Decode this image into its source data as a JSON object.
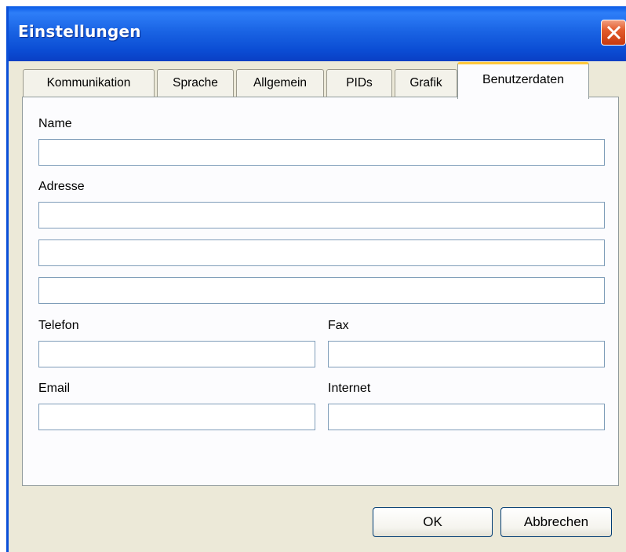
{
  "window": {
    "title": "Einstellungen"
  },
  "tabs": [
    {
      "label": "Kommunikation"
    },
    {
      "label": "Sprache"
    },
    {
      "label": "Allgemein"
    },
    {
      "label": "PIDs"
    },
    {
      "label": "Grafik"
    },
    {
      "label": "Benutzerdaten",
      "active": true
    }
  ],
  "form": {
    "name_label": "Name",
    "name_value": "",
    "address_label": "Adresse",
    "address_line1": "",
    "address_line2": "",
    "address_line3": "",
    "phone_label": "Telefon",
    "phone_value": "",
    "fax_label": "Fax",
    "fax_value": "",
    "email_label": "Email",
    "email_value": "",
    "internet_label": "Internet",
    "internet_value": ""
  },
  "buttons": {
    "ok_label": "OK",
    "cancel_label": "Abbrechen"
  },
  "icons": {
    "close": "close-icon"
  },
  "colors": {
    "title_bar": "#0A5BE6",
    "close_button": "#E35B2C",
    "dialog_bg": "#ECE9D8",
    "active_tab_accent": "#FFC83C"
  }
}
